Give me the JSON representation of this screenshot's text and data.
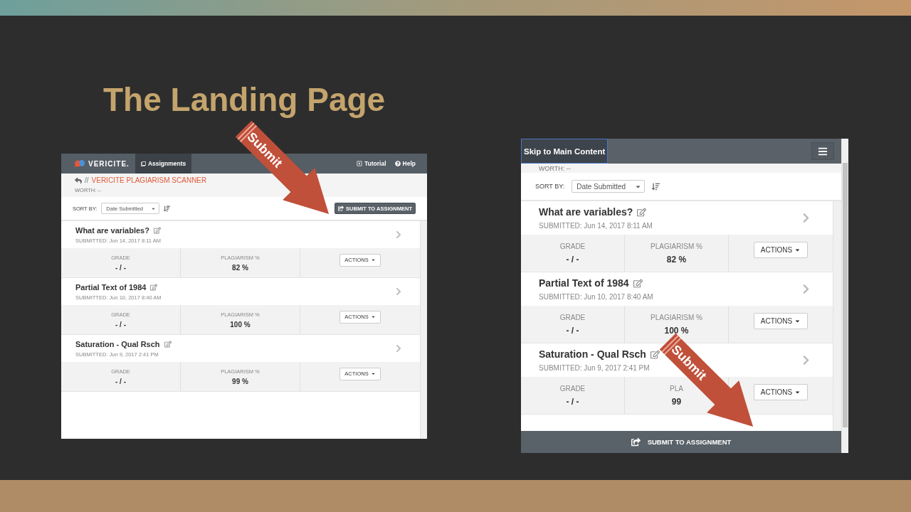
{
  "slide": {
    "title": "The Landing Page"
  },
  "callouts": [
    {
      "label": "Submit"
    },
    {
      "label": "Submit"
    }
  ],
  "desktop_view": {
    "nav": {
      "logo": "VERICITE.",
      "tabs": [
        {
          "label": "Assignments",
          "selected": true
        }
      ],
      "links": [
        {
          "kind": "tutorial",
          "label": "Tutorial"
        },
        {
          "kind": "help",
          "label": "Help"
        }
      ]
    },
    "breadcrumb": {
      "separator": "//",
      "title": "VERICITE PLAGIARISM SCANNER"
    },
    "worth": "WORTH: --",
    "sort": {
      "label": "SORT BY:",
      "value": "Date Submitted"
    },
    "submit_button": "SUBMIT TO ASSIGNMENT",
    "submissions": [
      {
        "title": "What are variables?",
        "submitted": "SUBMITTED: Jun 14, 2017 8:11 AM",
        "grade_label": "GRADE",
        "grade": "- / -",
        "plagiarism_label": "PLAGIARISM %",
        "plagiarism": "82 %",
        "actions": "ACTIONS"
      },
      {
        "title": "Partial Text of 1984",
        "submitted": "SUBMITTED: Jun 10, 2017 8:40 AM",
        "grade_label": "GRADE",
        "grade": "- / -",
        "plagiarism_label": "PLAGIARISM %",
        "plagiarism": "100 %",
        "actions": "ACTIONS"
      },
      {
        "title": "Saturation - Qual Rsch",
        "submitted": "SUBMITTED: Jun 9, 2017 2:41 PM",
        "grade_label": "GRADE",
        "grade": "- / -",
        "plagiarism_label": "PLAGIARISM %",
        "plagiarism": "99 %",
        "actions": "ACTIONS"
      }
    ]
  },
  "mobile_view": {
    "skip_link": "Skip to Main Content",
    "worth": "WORTH: --",
    "sort": {
      "label": "SORT BY:",
      "value": "Date Submitted"
    },
    "submissions": [
      {
        "title": "What are variables?",
        "submitted": "SUBMITTED: Jun 14, 2017 8:11 AM",
        "grade_label": "GRADE",
        "grade": "- / -",
        "plagiarism_label": "PLAGIARISM %",
        "plagiarism": "82 %",
        "actions": "ACTIONS"
      },
      {
        "title": "Partial Text of 1984",
        "submitted": "SUBMITTED: Jun 10, 2017 8:40 AM",
        "grade_label": "GRADE",
        "grade": "- / -",
        "plagiarism_label": "PLAGIARISM %",
        "plagiarism": "100 %",
        "actions": "ACTIONS"
      },
      {
        "title": "Saturation - Qual Rsch",
        "submitted": "SUBMITTED: Jun 9, 2017 2:41 PM",
        "grade_label": "GRADE",
        "grade": "- / -",
        "plagiarism_label": "PLA",
        "plagiarism": "99",
        "actions": "ACTIONS"
      }
    ],
    "submit_button": "SUBMIT TO ASSIGNMENT"
  }
}
